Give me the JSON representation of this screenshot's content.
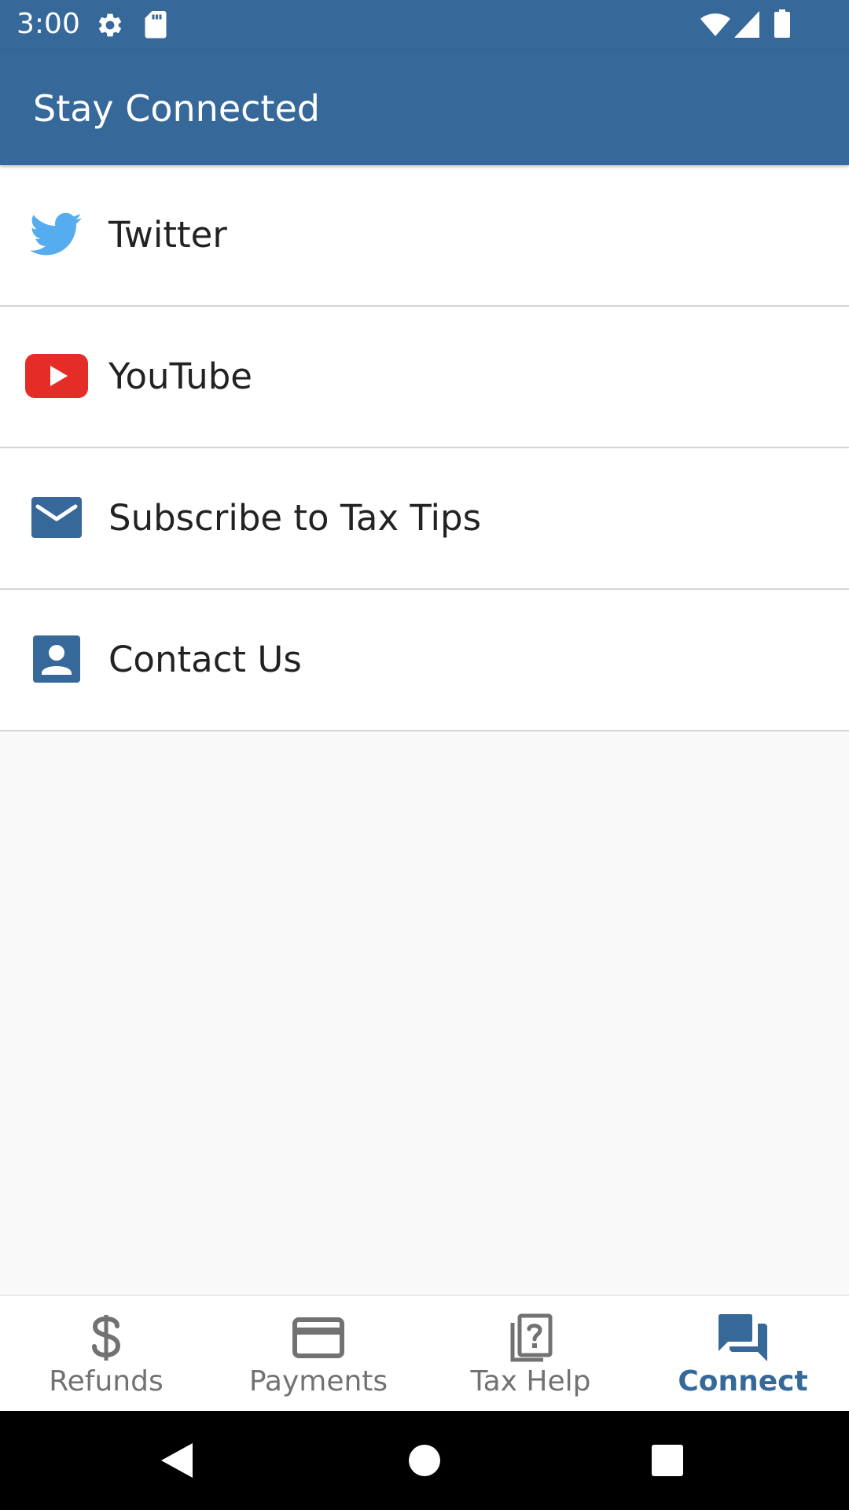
{
  "status_bar": {
    "time": "3:00",
    "icons": [
      "settings-icon",
      "sd-card-icon",
      "wifi-icon",
      "signal-icon",
      "battery-icon"
    ]
  },
  "app_bar": {
    "title": "Stay Connected"
  },
  "list": {
    "items": [
      {
        "label": "Twitter",
        "icon": "twitter-icon"
      },
      {
        "label": "YouTube",
        "icon": "youtube-icon"
      },
      {
        "label": "Subscribe to Tax Tips",
        "icon": "envelope-icon"
      },
      {
        "label": "Contact Us",
        "icon": "contact-card-icon"
      }
    ]
  },
  "bottom_nav": {
    "items": [
      {
        "label": "Refunds",
        "icon": "dollar-icon",
        "active": false
      },
      {
        "label": "Payments",
        "icon": "credit-card-icon",
        "active": false
      },
      {
        "label": "Tax Help",
        "icon": "help-book-icon",
        "active": false
      },
      {
        "label": "Connect",
        "icon": "chat-bubbles-icon",
        "active": true
      }
    ]
  },
  "system_nav": {
    "buttons": [
      "back-icon",
      "home-icon",
      "recents-icon"
    ]
  },
  "colors": {
    "primary": "#366899",
    "twitter": "#55acee",
    "youtube": "#e52d27",
    "nav_inactive": "#727272",
    "divider": "#d4d4d4",
    "background": "#f9f9f9"
  }
}
